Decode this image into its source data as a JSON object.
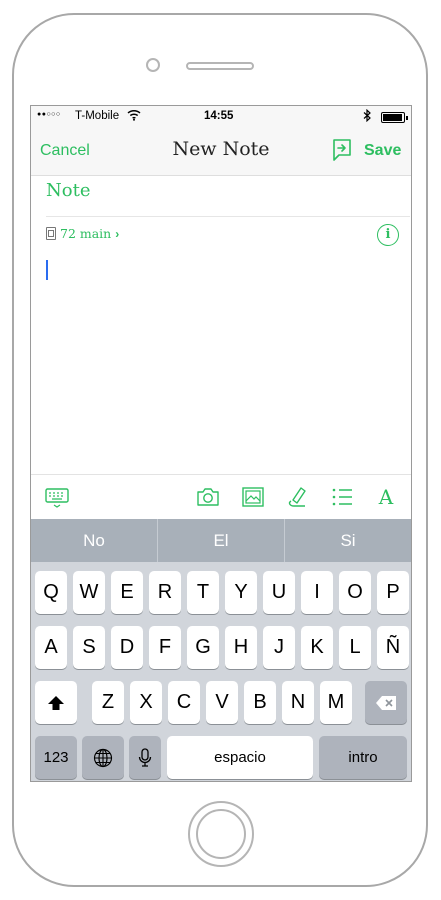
{
  "status_bar": {
    "signal_dots": "●●○○○",
    "carrier": "T-Mobile",
    "wifi_icon": "wifi-icon",
    "time": "14:55",
    "bluetooth_icon": "bluetooth-icon",
    "battery_level": 0.95
  },
  "nav": {
    "cancel": "Cancel",
    "title": "New Note",
    "share_icon": "share-icon",
    "save": "Save"
  },
  "note": {
    "title_placeholder": "Note",
    "notebook": "72 main",
    "notebook_icon": "notebook-icon",
    "info_label": "i",
    "body": ""
  },
  "toolbar": {
    "icons": [
      "keyboard-icon",
      "camera-icon",
      "image-icon",
      "sketch-icon",
      "list-icon",
      "format-icon"
    ],
    "format_label": "A"
  },
  "keyboard": {
    "suggestions": [
      "No",
      "El",
      "Si"
    ],
    "row1": [
      "Q",
      "W",
      "E",
      "R",
      "T",
      "Y",
      "U",
      "I",
      "O",
      "P"
    ],
    "row2": [
      "A",
      "S",
      "D",
      "F",
      "G",
      "H",
      "J",
      "K",
      "L",
      "Ñ"
    ],
    "row3": [
      "Z",
      "X",
      "C",
      "V",
      "B",
      "N",
      "M"
    ],
    "numbers": "123",
    "space": "espacio",
    "return": "intro"
  },
  "colors": {
    "accent": "#2dbe60",
    "cursor": "#2a6cf0",
    "suggestion_bar": "#a8b0b9"
  }
}
